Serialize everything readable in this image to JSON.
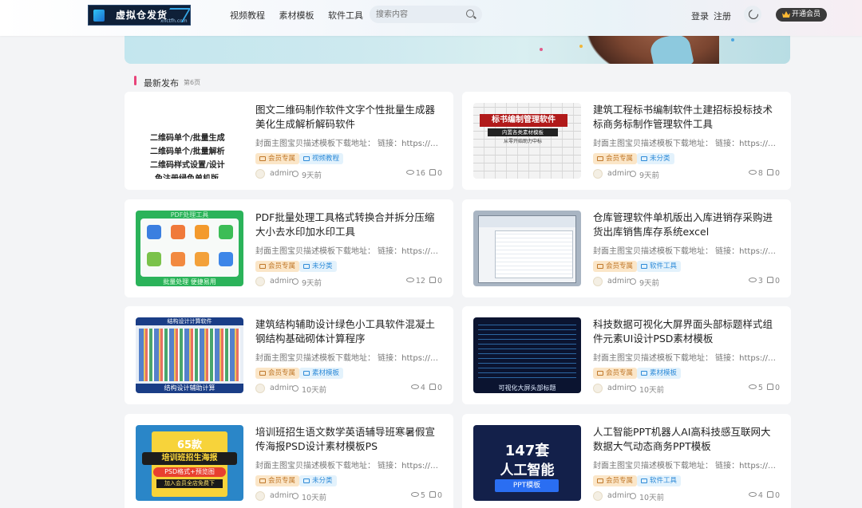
{
  "header": {
    "logo_text": "虚拟仓发货",
    "logo_sub": "xnctfh.com",
    "nav": [
      "视频教程",
      "素材模板",
      "软件工具"
    ],
    "search_placeholder": "搜索内容",
    "login": "登录",
    "register": "注册",
    "vip_button": "开通会员"
  },
  "section": {
    "title": "最新发布",
    "page": "第6页"
  },
  "common": {
    "desc": "封面主图宝贝描述模板下载地址： 链接：https://pan.baidu.com",
    "vip_tag": "会员专属",
    "author": "admin"
  },
  "cards": [
    {
      "title": "图文二维码制作软件文字个性批量生成器美化生成解析解码软件",
      "category": "视频教程",
      "time": "9天前",
      "views": "16",
      "likes": "0",
      "thumb_lines": [
        "二维码单个/批量生成",
        "二维码单个/批量解析",
        "二维码样式设置/设计",
        "免注册绿色单机版"
      ]
    },
    {
      "title": "建筑工程标书编制软件土建招标投标技术标商务标制作管理软件工具",
      "category": "未分类",
      "time": "9天前",
      "views": "8",
      "likes": "0",
      "thumb_lines": [
        "标书编制管理软件",
        "内置各类素材模板",
        "从零开始助力中标"
      ]
    },
    {
      "title": "PDF批量处理工具格式转换合并拆分压缩大小去水印加水印工具",
      "category": "未分类",
      "time": "9天前",
      "views": "12",
      "likes": "0",
      "thumb_lines": [
        "PDF处理工具",
        "批量处理 便捷易用"
      ]
    },
    {
      "title": "仓库管理软件单机版出入库进销存采购进货出库销售库存系统excel",
      "category": "软件工具",
      "time": "9天前",
      "views": "3",
      "likes": "0",
      "thumb_lines": []
    },
    {
      "title": "建筑结构辅助设计绿色小工具软件混凝土钢结构基础砌体计算程序",
      "category": "素材模板",
      "time": "10天前",
      "views": "4",
      "likes": "0",
      "thumb_lines": [
        "结构设计计算软件",
        "结构设计辅助计算"
      ]
    },
    {
      "title": "科技数据可视化大屏界面头部标题样式组件元素UI设计PSD素材模板",
      "category": "素材模板",
      "time": "10天前",
      "views": "5",
      "likes": "0",
      "thumb_lines": [
        "可视化大屏头部标题"
      ]
    },
    {
      "title": "培训班招生语文数学英语辅导班寒暑假宣传海报PSD设计素材模板PS",
      "category": "未分类",
      "time": "10天前",
      "views": "5",
      "likes": "0",
      "thumb_lines": [
        "65款",
        "培训班招生海报",
        "PSD格式+预览图",
        "加入会员全店免费下"
      ]
    },
    {
      "title": "人工智能PPT机器人AI高科技感互联网大数据大气动态商务PPT模板",
      "category": "软件工具",
      "time": "10天前",
      "views": "4",
      "likes": "0",
      "thumb_lines": [
        "147套",
        "人工智能",
        "PPT模板"
      ]
    }
  ]
}
